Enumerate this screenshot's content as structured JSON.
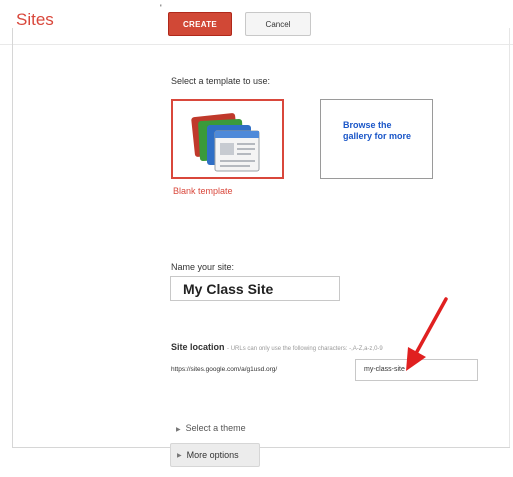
{
  "app": {
    "logo": "Sites"
  },
  "toolbar": {
    "create_label": "CREATE",
    "cancel_label": "Cancel"
  },
  "templates": {
    "heading": "Select a template to use:",
    "blank_label": "Blank template",
    "browse_label": "Browse the gallery for more"
  },
  "name": {
    "label": "Name your site:",
    "value": "My Class Site"
  },
  "location": {
    "label": "Site location",
    "help": "- URLs can only use the following characters: -,A-Z,a-z,0-9",
    "prefix": "https://sites.google.com/a/g1usd.org/",
    "value": "my-class-site"
  },
  "options": {
    "theme_label": "Select a theme",
    "more_label": "More options"
  },
  "colors": {
    "accent": "#d14836",
    "arrow": "#e02020",
    "link": "#1a56c8"
  }
}
